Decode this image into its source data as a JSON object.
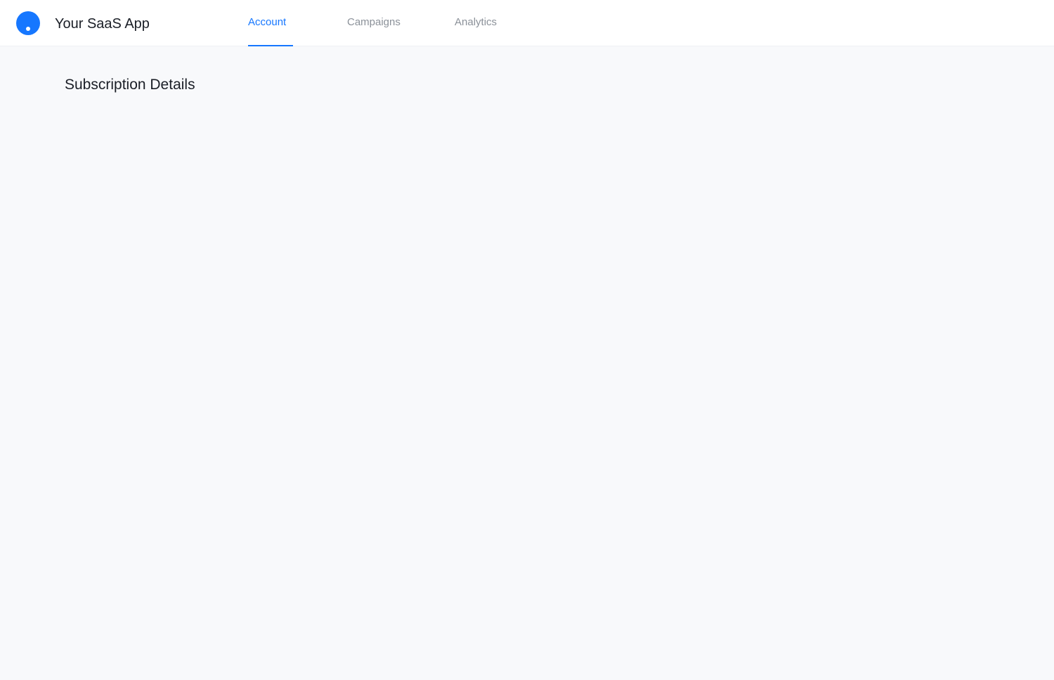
{
  "app": {
    "name": "Your SaaS App",
    "logo_icon": "circle-logo-icon",
    "accent_color": "#1677ff"
  },
  "nav": {
    "tabs": [
      {
        "label": "Account",
        "active": true
      },
      {
        "label": "Campaigns",
        "active": false
      },
      {
        "label": "Analytics",
        "active": false
      }
    ]
  },
  "main": {
    "title": "Subscription Details"
  }
}
